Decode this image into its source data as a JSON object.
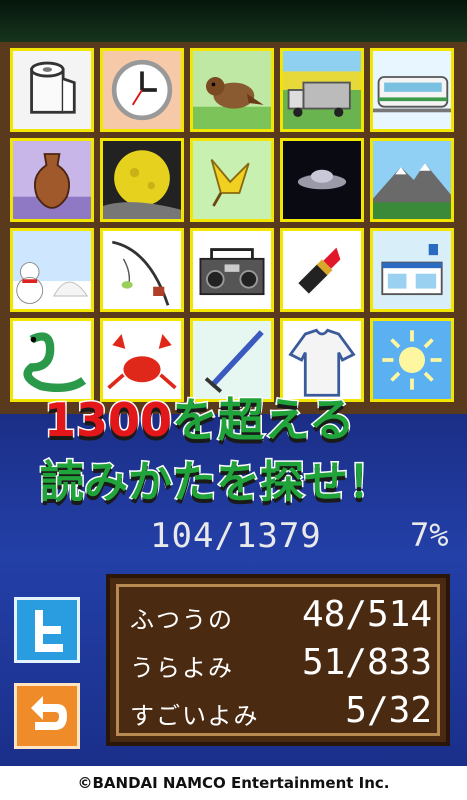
{
  "banner": {
    "line1_num": "1300",
    "line1_rest": "を超える",
    "line2": "読みかたを探せ！"
  },
  "progress": {
    "total": "104/1379",
    "percent": "7%"
  },
  "stats": [
    {
      "label": "ふつうの",
      "value": "48/514"
    },
    {
      "label": "うらよみ",
      "value": "51/833"
    },
    {
      "label": "すごいよみ",
      "value": "5/32"
    }
  ],
  "tiles": [
    "toilet-paper",
    "clock",
    "sparrow",
    "truck",
    "train",
    "vase",
    "moon",
    "bird",
    "ufo",
    "mountain",
    "snowman",
    "fishing-rod",
    "radio",
    "lipstick",
    "convenience-store",
    "snake",
    "crab",
    "sword",
    "shirt",
    "sun"
  ],
  "copyright": "©BANDAI NAMCO Entertainment Inc.",
  "colors": {
    "accent_red": "#e3171a",
    "accent_green": "#1fa33a",
    "tile_border": "#f2e600",
    "panel": "#4b2a12"
  }
}
